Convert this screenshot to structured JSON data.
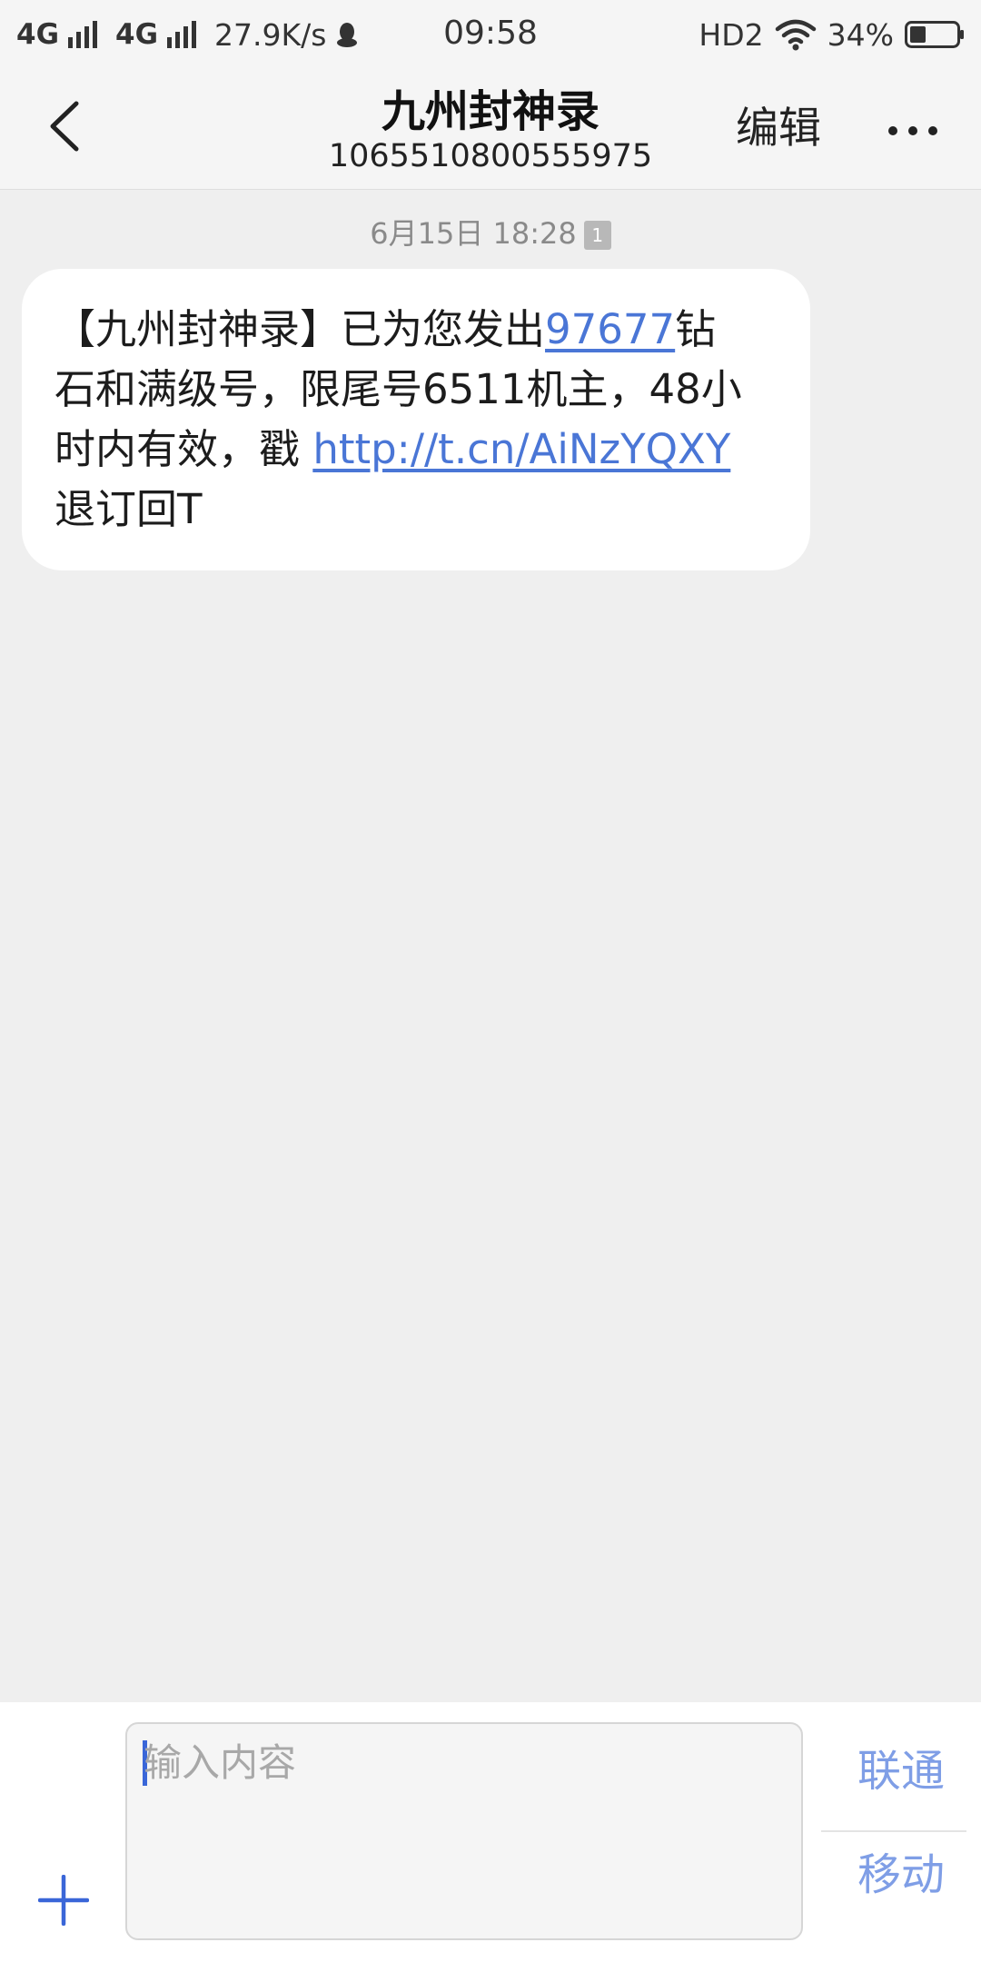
{
  "status_bar": {
    "network_1": "4G",
    "network_2": "4G",
    "speed": "27.9K/s",
    "time": "09:58",
    "hd": "HD2",
    "battery": "34%"
  },
  "header": {
    "contact_name": "九州封神录",
    "contact_number": "1065510800555975",
    "edit_label": "编辑"
  },
  "conversation": {
    "timestamp": "6月15日 18:28",
    "sim_badge": "1",
    "message": {
      "line1_prefix": "【九州封神录】已为您发出",
      "line1_link": "97677",
      "line1_suffix": "钻",
      "line2": "石和满级号，限尾号6511机主，48小",
      "line3_prefix": "时内有效，戳 ",
      "line3_link": "http://t.cn/AiNzYQXY",
      "line4": "退订回T"
    }
  },
  "compose": {
    "placeholder": "输入内容",
    "value": "",
    "send_sim1": "联通",
    "send_sim2": "移动"
  },
  "colors": {
    "link": "#4a76d6",
    "send_label": "#7f9ee6",
    "accent": "#3a66d8",
    "background": "#efefef"
  },
  "icons": {
    "back": "chevron-left-icon",
    "more": "more-dots-icon",
    "add": "plus-icon",
    "wifi": "wifi-icon",
    "battery": "battery-icon",
    "qq": "qq-penguin-icon"
  }
}
